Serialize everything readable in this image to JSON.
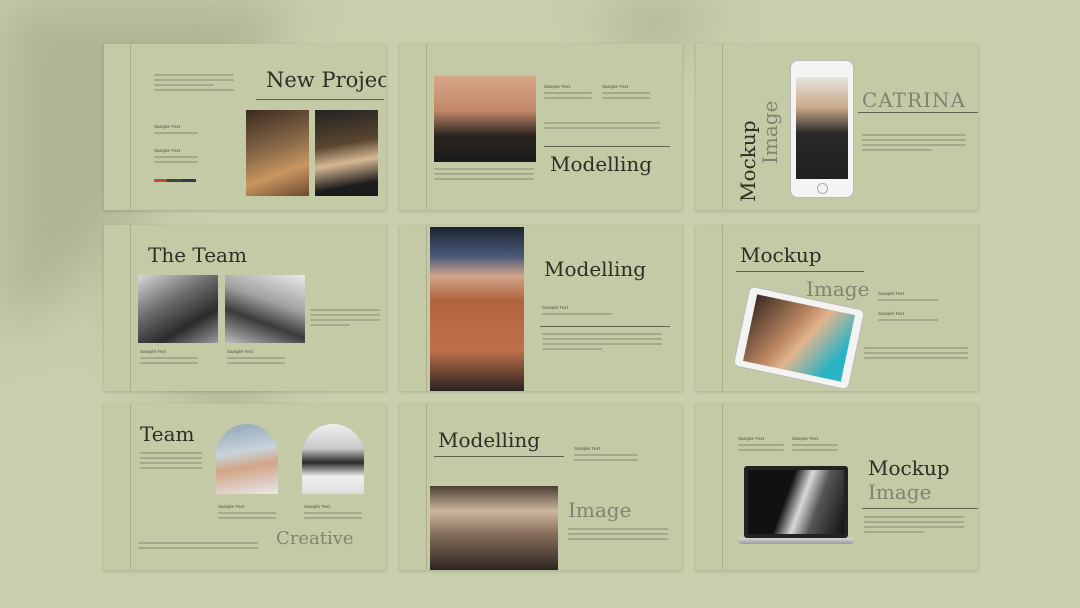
{
  "slides": {
    "s1": {
      "title": "New Project",
      "label1": "Sample Text",
      "label2": "Sample Text"
    },
    "s2": {
      "title": "Modelling",
      "label1": "Sample Text",
      "label2": "Sample Text"
    },
    "s3": {
      "title": "CATRINA",
      "mockup1": "Mockup",
      "mockup2": "Image"
    },
    "s4": {
      "title": "The Team",
      "label1": "Sample Text",
      "label2": "Sample Text"
    },
    "s5": {
      "title": "Modelling",
      "label1": "Sample Text"
    },
    "s6": {
      "title": "Mockup",
      "subtitle": "Image",
      "label1": "Sample Text",
      "label2": "Sample Text"
    },
    "s7": {
      "title": "Team",
      "subtitle": "Creative",
      "label1": "Sample Text",
      "label2": "Sample Text"
    },
    "s8": {
      "title": "Modelling",
      "subtitle": "Image",
      "label1": "Sample Text"
    },
    "s9": {
      "title1": "Mockup",
      "title2": "Image",
      "label1": "Sample Text",
      "label2": "Sample Text"
    }
  },
  "colors": {
    "background": "#c9cfad",
    "slide": "#c4caa5",
    "title": "#2c2f24",
    "muted": "#7e8570"
  }
}
